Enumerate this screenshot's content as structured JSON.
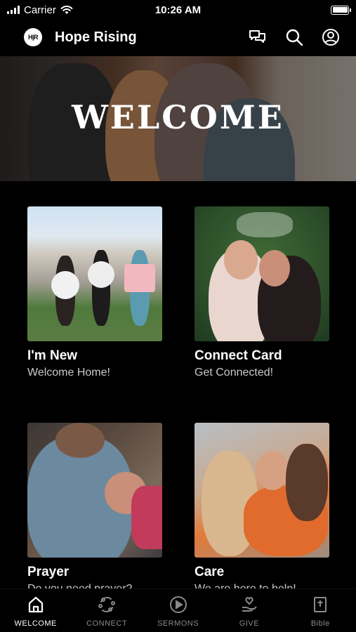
{
  "status_bar": {
    "carrier": "Carrier",
    "time": "10:26 AM"
  },
  "app": {
    "logo_text": "H|R",
    "title": "Hope Rising"
  },
  "header_icons": [
    "chat-icon",
    "search-icon",
    "profile-icon"
  ],
  "hero": {
    "title": "WELCOME"
  },
  "cards": [
    {
      "title": "I'm New",
      "subtitle": "Welcome Home!"
    },
    {
      "title": "Connect Card",
      "subtitle": "Get Connected!"
    },
    {
      "title": "Prayer",
      "subtitle": "Do you need prayer?"
    },
    {
      "title": "Care",
      "subtitle": "We are here to help!"
    }
  ],
  "nav": [
    {
      "label": "WELCOME",
      "icon": "home-icon",
      "active": true
    },
    {
      "label": "CONNECT",
      "icon": "connect-icon",
      "active": false
    },
    {
      "label": "SERMONS",
      "icon": "play-icon",
      "active": false
    },
    {
      "label": "GIVE",
      "icon": "give-icon",
      "active": false
    },
    {
      "label": "Bible",
      "icon": "bible-icon",
      "active": false
    }
  ],
  "colors": {
    "background": "#000000",
    "text": "#ffffff",
    "inactive": "#8a8a8a",
    "subtitle": "#c9c9c9"
  }
}
